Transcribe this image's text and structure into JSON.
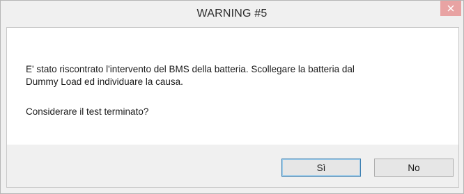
{
  "dialog": {
    "title": "WARNING #5",
    "close_glyph": "✕",
    "message_line_1": "E' stato riscontrato l'intervento del BMS della batteria. Scollegare la batteria dal",
    "message_line_2": "Dummy Load ed individuare la causa.",
    "question": "Considerare il test terminato?",
    "buttons": {
      "yes_label": "Sì",
      "no_label": "No"
    }
  },
  "colors": {
    "close_button_bg": "#e8a3a3",
    "default_button_border": "#3c7fb1"
  },
  "icons": {
    "close": "close-icon"
  }
}
